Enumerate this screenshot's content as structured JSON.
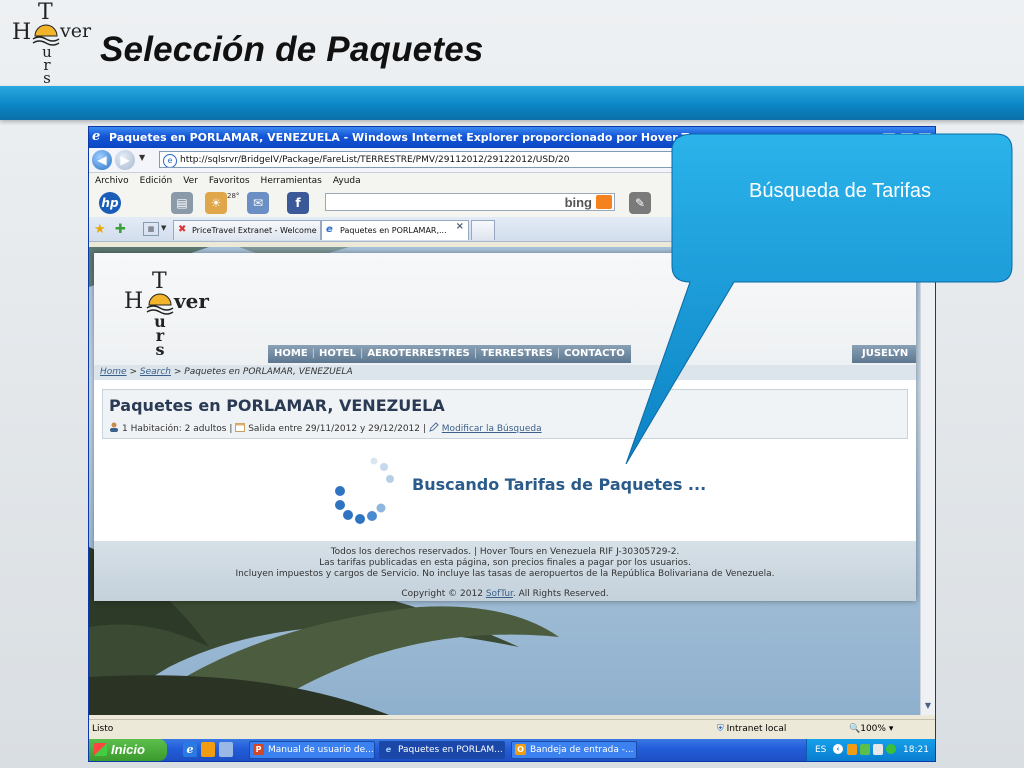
{
  "slide": {
    "title": "Selección de Paquetes",
    "logo": {
      "t": "T",
      "h": "H",
      "ver": "ver",
      "u": "u",
      "r": "r",
      "s": "s"
    }
  },
  "callout": {
    "text": "Búsqueda de Tarifas"
  },
  "browser": {
    "title": "Paquetes en PORLAMAR, VENEZUELA - Windows Internet Explorer proporcionado por Hover Tours",
    "address": "http://sqlsrvr/BridgeIV/Package/FareList/TERRESTRE/PMV/29112012/29122012/USD/20",
    "menu": [
      "Archivo",
      "Edición",
      "Ver",
      "Favoritos",
      "Herramientas",
      "Ayuda"
    ],
    "search_brand": "bing",
    "weather_temp": "28°",
    "tabs": [
      {
        "label": "PriceTravel Extranet - Welcome"
      },
      {
        "label": "Paquetes en PORLAMAR,..."
      }
    ],
    "status": {
      "left": "Listo",
      "zone": "Intranet local",
      "zoom": "100%"
    }
  },
  "page": {
    "logo": {
      "t": "T",
      "h": "H",
      "ver": "ver",
      "u": "u",
      "r": "r",
      "s": "s"
    },
    "nav": [
      "HOME",
      "HOTEL",
      "AEROTERRESTRES",
      "TERRESTRES",
      "CONTACTO"
    ],
    "user": "JUSELYN",
    "breadcrumb": {
      "home": "Home",
      "search": "Search",
      "current": "> Paquetes en PORLAMAR, VENEZUELA"
    },
    "result_title": "Paquetes en PORLAMAR, VENEZUELA",
    "info": {
      "rooms": "1 Habitación: 2 adultos",
      "dates": "Salida entre 29/11/2012 y 29/12/2012",
      "modify": "Modificar la Búsqueda"
    },
    "loading_text": "Buscando Tarifas de Paquetes ...",
    "footer": {
      "line1": "Todos los derechos reservados. | Hover Tours en Venezuela RIF J-30305729-2.",
      "line2": "Las tarifas publicadas en esta página, son precios finales a pagar por los usuarios.",
      "line3": "Incluyen impuestos y cargos de Servicio. No incluye las tasas de aeropuertos de la República Bolivariana de Venezuela.",
      "copyright_pre": "Copyright © 2012",
      "copyright_link": "SofTur",
      "copyright_post": ". All Rights Reserved."
    }
  },
  "taskbar": {
    "start": "Inicio",
    "buttons": [
      {
        "label": "Manual de usuario de..."
      },
      {
        "label": "Paquetes en PORLAM..."
      },
      {
        "label": "Bandeja de entrada -..."
      }
    ],
    "lang": "ES",
    "time": "18:21"
  },
  "colors": {
    "band": "#0c86c7",
    "callout": "#1a9fdc",
    "nav": "#6f88a0",
    "title_bar": "#1456d6"
  }
}
